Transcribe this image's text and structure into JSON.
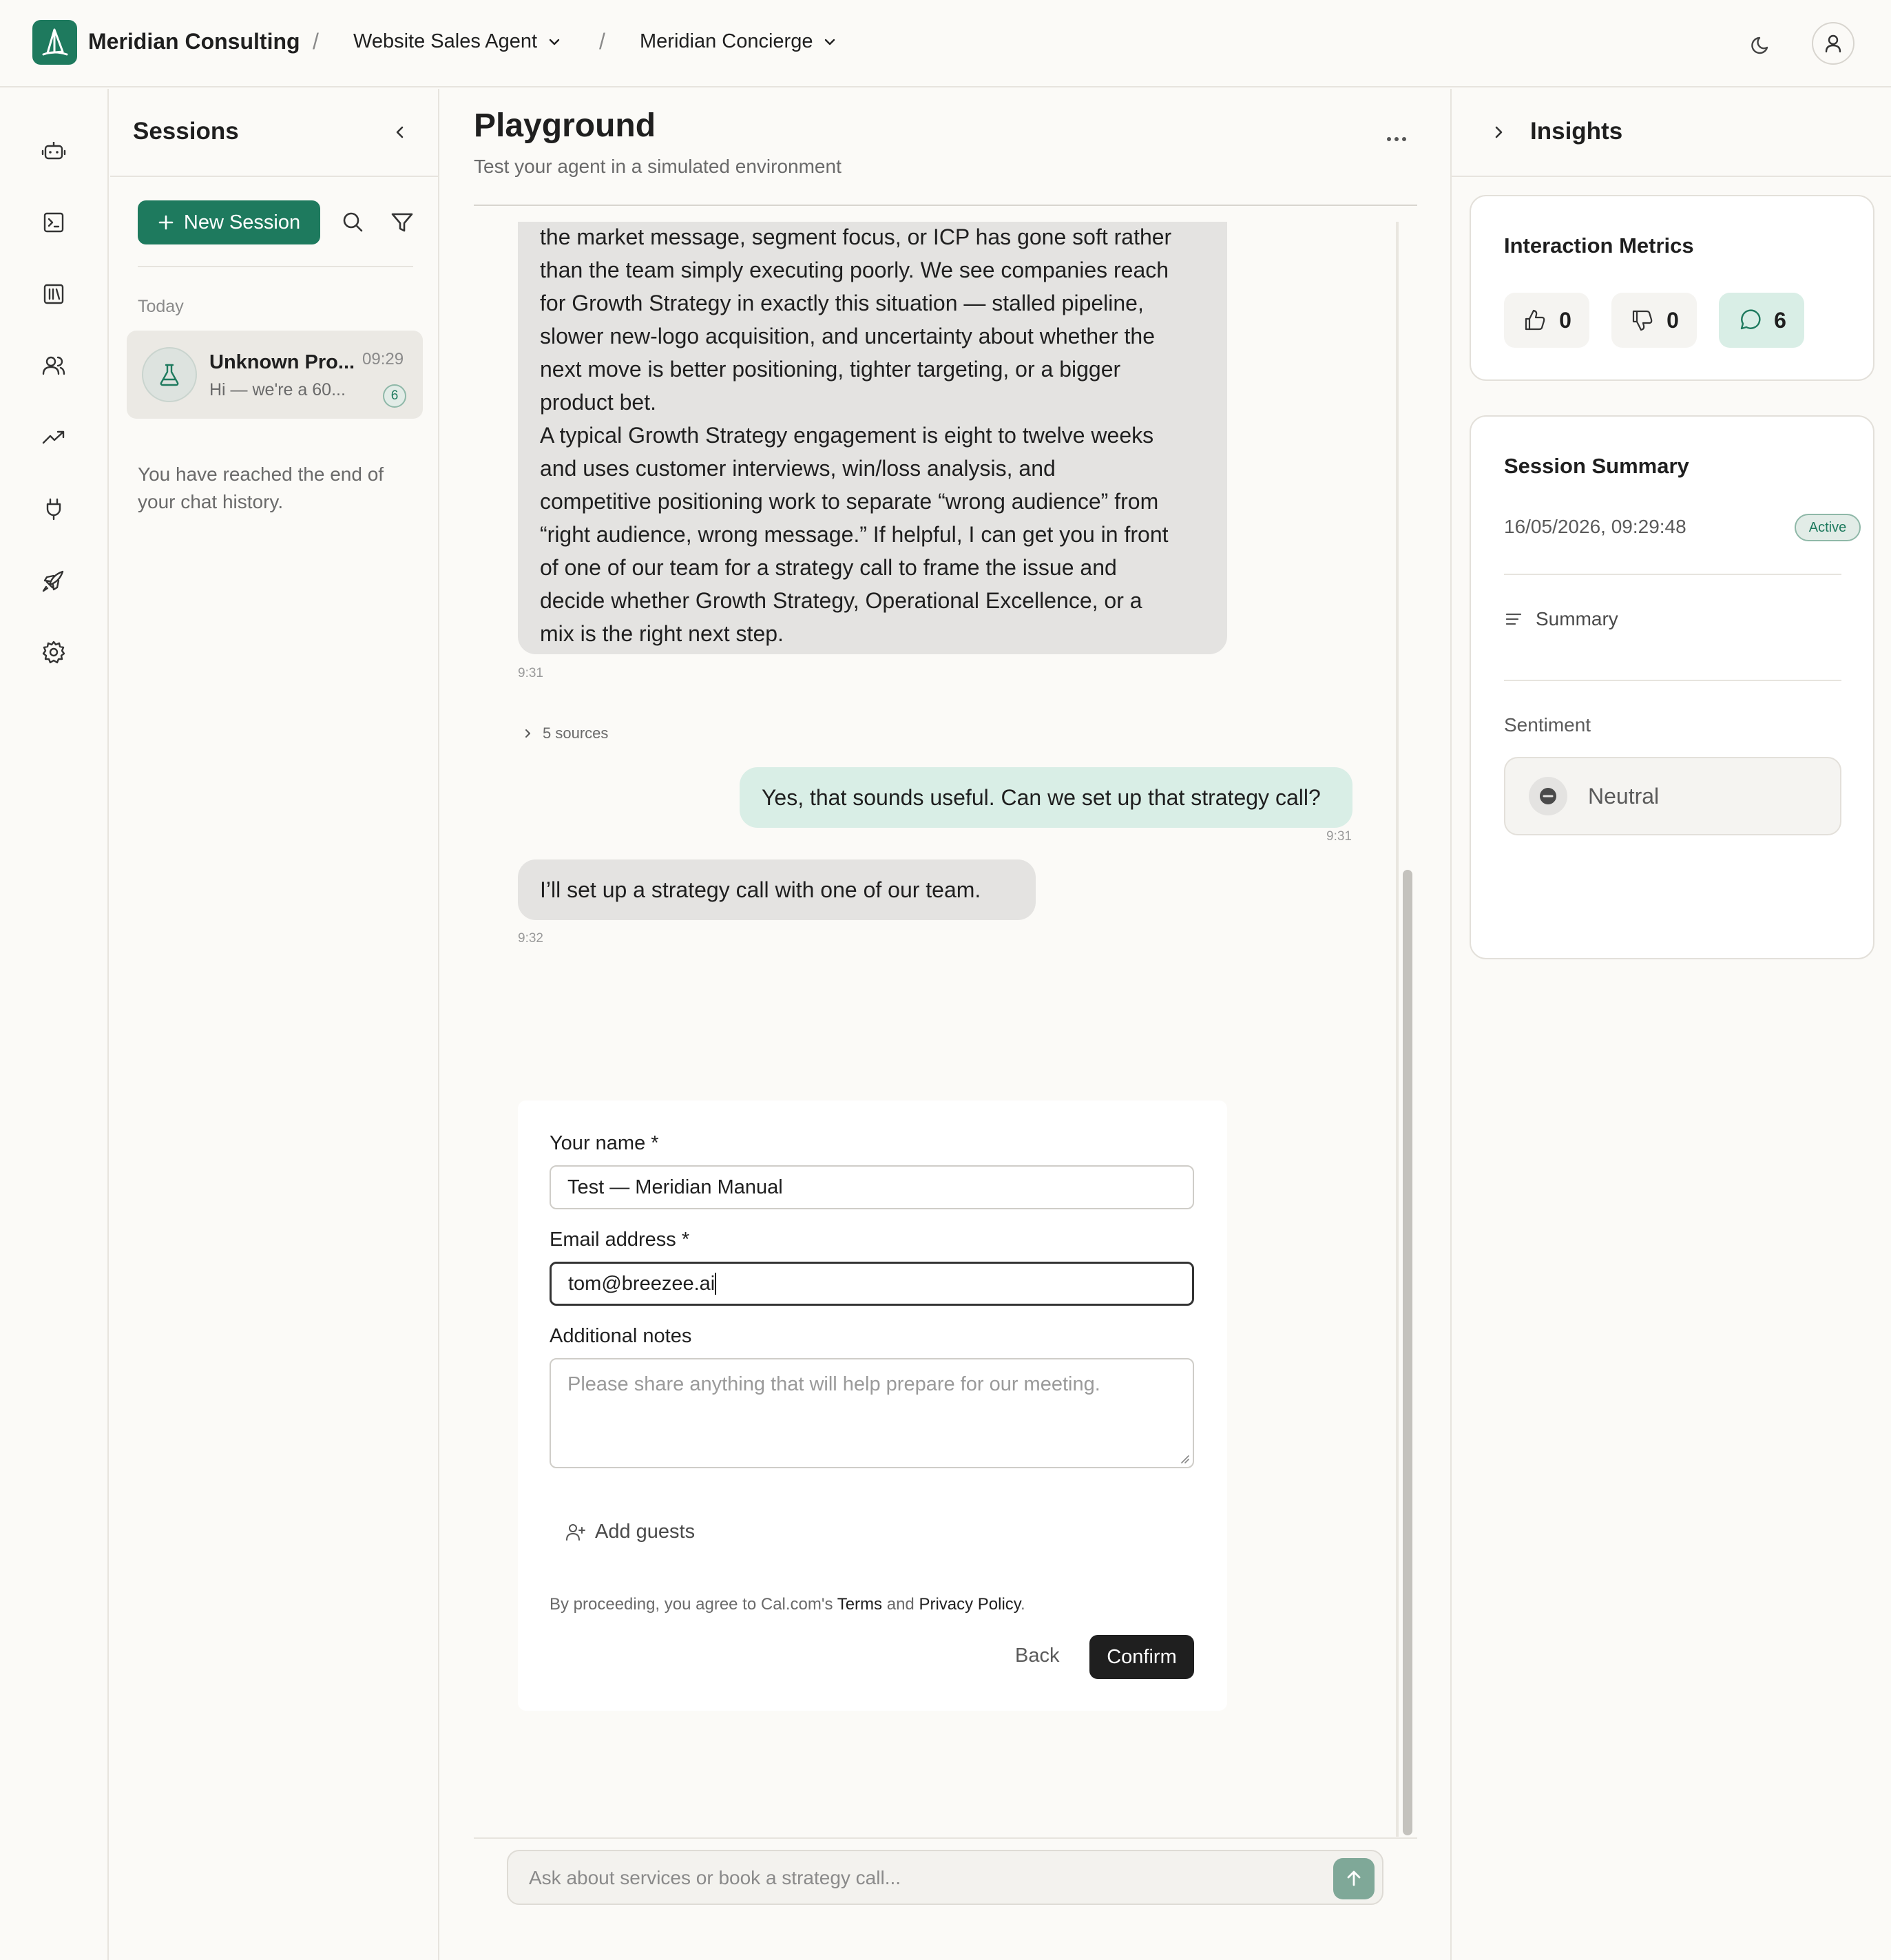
{
  "topbar": {
    "brand": "Meridian Consulting",
    "separator": "/",
    "agent": "Website Sales Agent",
    "persona": "Meridian Concierge"
  },
  "sessions": {
    "title": "Sessions",
    "new_session_label": "New Session",
    "group_label": "Today",
    "items": [
      {
        "name": "Unknown Pro...",
        "time": "09:29",
        "preview": "Hi — we're a 60...",
        "count": "6"
      }
    ],
    "end_note": "You have reached the end of your chat history."
  },
  "main": {
    "title": "Playground",
    "subtitle": "Test your agent in a simulated environment",
    "messages": [
      {
        "role": "bot",
        "lines": [
          "the market message, segment focus, or ICP has gone soft rather",
          "than the team simply executing poorly. We see companies reach",
          "for Growth Strategy in exactly this situation — stalled pipeline,",
          "slower new-logo acquisition, and uncertainty about whether the",
          "next move is better positioning, tighter targeting, or a bigger",
          "product bet.",
          "A typical Growth Strategy engagement is eight to twelve weeks",
          "and uses customer interviews, win/loss analysis, and",
          "competitive positioning work to separate “wrong audience” from",
          "“right audience, wrong message.” If helpful, I can get you in front",
          "of one of our team for a strategy call to frame the issue and",
          "decide whether Growth Strategy, Operational Excellence, or a",
          "mix is the right next step."
        ],
        "time": "9:31",
        "sources": "5 sources"
      },
      {
        "role": "user",
        "text": "Yes, that sounds useful. Can we set up that strategy call?",
        "time": "9:31"
      },
      {
        "role": "bot",
        "text": "I’ll set up a strategy call with one of our team.",
        "time": "9:32"
      }
    ],
    "composer_placeholder": "Ask about services or book a strategy call..."
  },
  "form": {
    "name_label": "Your name",
    "name_value": "Test — Meridian Manual",
    "email_label": "Email address",
    "email_value": "tom@breezee.ai",
    "required_mark": "*",
    "notes_label": "Additional notes",
    "notes_placeholder": "Please share anything that will help prepare for our meeting.",
    "add_guests": "Add guests",
    "legal_prefix": "By proceeding, you agree to Cal.com's",
    "terms": "Terms",
    "and": "and",
    "privacy": "Privacy Policy",
    "period": ".",
    "back": "Back",
    "confirm": "Confirm"
  },
  "insights": {
    "title": "Insights",
    "metrics_title": "Interaction Metrics",
    "likes": "0",
    "dislikes": "0",
    "messages": "6",
    "summary_title": "Session Summary",
    "session_date": "16/05/2026, 09:29:48",
    "status": "Active",
    "summary_label": "Summary",
    "sentiment_label": "Sentiment",
    "sentiment_value": "Neutral"
  },
  "colors": {
    "accent": "#1e7a5e",
    "user_bubble": "#d9eee6",
    "bot_bubble": "#e4e3e1"
  }
}
